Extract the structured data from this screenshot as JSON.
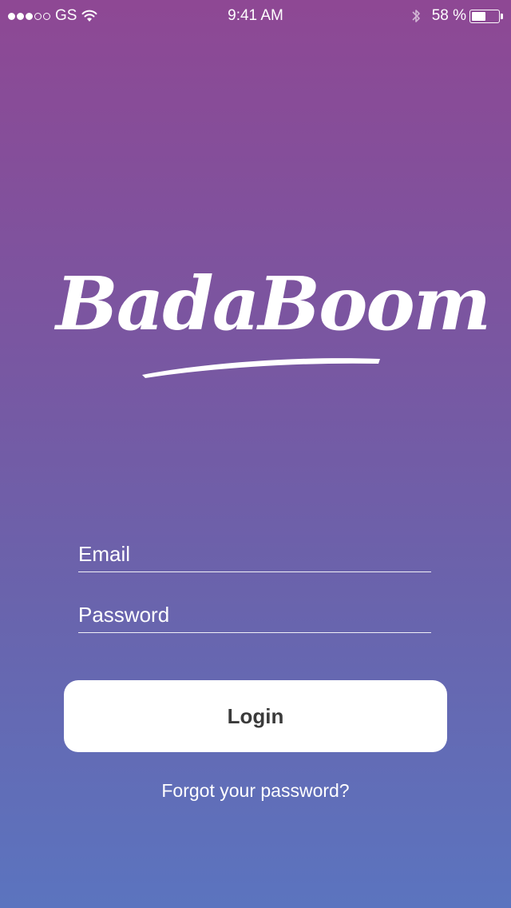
{
  "status_bar": {
    "signal_strength": 3,
    "signal_max": 5,
    "carrier": "GS",
    "wifi_icon": "wifi-icon",
    "time": "9:41 AM",
    "bluetooth_icon": "bluetooth-icon",
    "battery_text": "58 %",
    "battery_level": 0.58
  },
  "logo": {
    "text": "BadaBoom"
  },
  "login_form": {
    "email_placeholder": "Email",
    "email_value": "",
    "password_placeholder": "Password",
    "password_value": "",
    "login_label": "Login",
    "forgot_label": "Forgot your password?"
  },
  "colors": {
    "gradient_top": "#8e4894",
    "gradient_bottom": "#5b74bf",
    "button_bg": "#ffffff",
    "button_text": "#3a3a3a"
  }
}
